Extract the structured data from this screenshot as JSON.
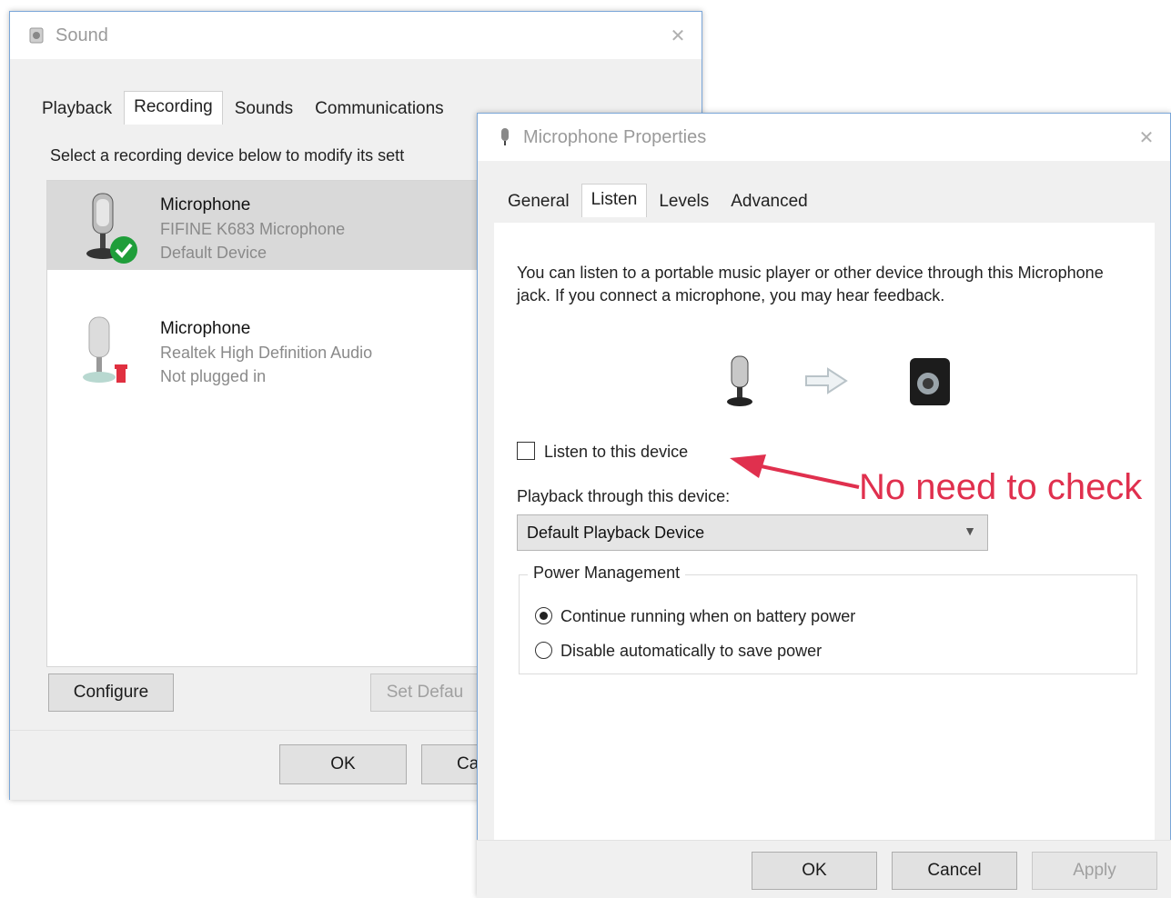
{
  "sound_window": {
    "title": "Sound",
    "tabs": [
      "Playback",
      "Recording",
      "Sounds",
      "Communications"
    ],
    "active_tab": "Recording",
    "instruction": "Select a recording device below to modify its sett",
    "devices": [
      {
        "name": "Microphone",
        "line2": "FIFINE K683 Microphone",
        "line3": "Default Device",
        "status": "default-check"
      },
      {
        "name": "Microphone",
        "line2": "Realtek High Definition Audio",
        "line3": "Not plugged in",
        "status": "unplugged"
      }
    ],
    "buttons": {
      "configure": "Configure",
      "set_default": "Set Defau",
      "ok": "OK",
      "cancel": "Ca"
    }
  },
  "props_window": {
    "title": "Microphone Properties",
    "tabs": [
      "General",
      "Listen",
      "Levels",
      "Advanced"
    ],
    "active_tab": "Listen",
    "description": "You can listen to a portable music player or other device through this Microphone jack.  If you connect a microphone, you may hear feedback.",
    "listen_checkbox_label": "Listen to this device",
    "listen_checked": false,
    "playback_label": "Playback through this device:",
    "playback_value": "Default Playback Device",
    "power_group_title": "Power Management",
    "power_options": [
      {
        "label": "Continue running when on battery power",
        "selected": true
      },
      {
        "label": "Disable automatically to save power",
        "selected": false
      }
    ],
    "buttons": {
      "ok": "OK",
      "cancel": "Cancel",
      "apply": "Apply"
    }
  },
  "annotation": {
    "text": "No need to check",
    "color": "#e0304e"
  }
}
